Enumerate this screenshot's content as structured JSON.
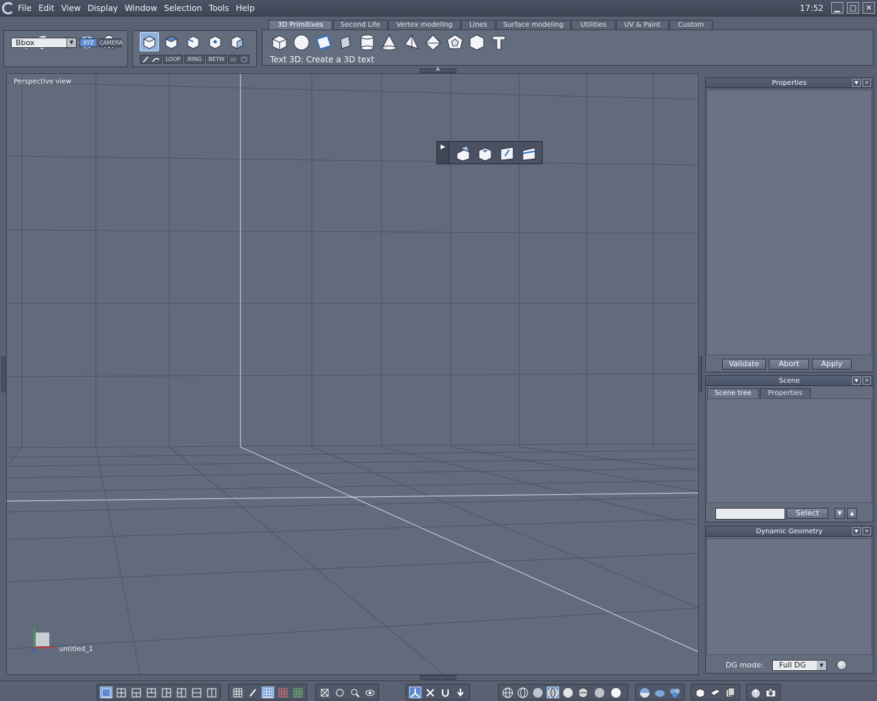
{
  "menubar": {
    "items": [
      "File",
      "Edit",
      "View",
      "Display",
      "Window",
      "Selection",
      "Tools",
      "Help"
    ],
    "clock": "17:52"
  },
  "window_controls": {
    "minimize": "▁",
    "maximize": "□",
    "close": "✕"
  },
  "toolbar": {
    "bbox_select": "Bbox",
    "xyz_label": "XYZ",
    "camera_label": "CAMERA",
    "loop_label": "LOOP",
    "ring_label": "RING",
    "betw_label": "BETW"
  },
  "tabs": [
    "3D Primitives",
    "Second Life",
    "Vertex modeling",
    "Lines",
    "Surface modeling",
    "Utilities",
    "UV & Paint",
    "Custom"
  ],
  "status_text": "Text 3D: Create a 3D text",
  "viewport": {
    "label": "Perspective view",
    "scene_name": "untitled_1"
  },
  "panels": {
    "properties": {
      "title": "Properties",
      "validate": "Validate",
      "abort": "Abort",
      "apply": "Apply"
    },
    "scene": {
      "title": "Scene",
      "tab_scene_tree": "Scene tree",
      "tab_properties": "Properties",
      "select_button": "Select"
    },
    "dynamic_geometry": {
      "title": "Dynamic Geometry",
      "dg_mode_label": "DG mode:",
      "dg_mode_value": "Full DG"
    }
  },
  "colors": {
    "background": "#596172",
    "viewport": "#626b7c",
    "accent": "#5c8ad0",
    "grid_line": "#4b5364",
    "axis_line": "#d6dbe4"
  }
}
